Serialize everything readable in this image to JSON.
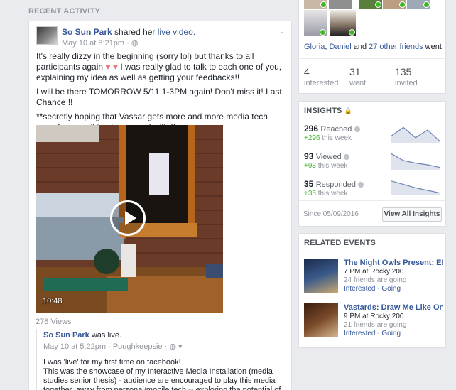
{
  "section_title": "RECENT ACTIVITY",
  "post": {
    "author": "So Sun Park",
    "action_prefix": "shared her",
    "action_link": "live video.",
    "time": "May 10 at 8:21pm ·",
    "menu_glyph": "⌄",
    "paragraphs": [
      "It's really dizzy in the beginning (sorry lol) but thanks to all participants again",
      "I will be there TOMORROW 5/11 1-3PM again! Don't miss it! Last Chance !!",
      "**secretly hoping that Vassar gets more and more media tech resrc for you all to play around with !!"
    ],
    "hearts": "♥ ♥",
    "para1_tail": "I was really glad to talk to each one of you, explaining my idea as well as getting your feedbacks!!",
    "video_duration": "10:48",
    "views": "278 Views",
    "shared": {
      "author": "So Sun Park",
      "action": "was live.",
      "meta": "May 10 at 5:22pm · Poughkeepsie · ",
      "body_lines": [
        "I was 'live' for my first time on facebook!",
        "This was the showcase of my Interactive Media Installation (media studies senior thesis) - audience are encouraged to play this media together, away from personal/mobile tech -- exploring the potential of tech creating live social interaction"
      ]
    }
  },
  "friends": {
    "names_a": "Gloria",
    "names_b": "Daniel",
    "and": "and",
    "others": "27 other friends",
    "went": "went",
    "sep": ", "
  },
  "stats": [
    {
      "num": "4",
      "label": "interested"
    },
    {
      "num": "31",
      "label": "went"
    },
    {
      "num": "135",
      "label": "invited"
    }
  ],
  "insights": {
    "title": "INSIGHTS",
    "lock_icon": "lock-icon",
    "metrics": [
      {
        "value": "296",
        "label": "Reached",
        "delta": "+296",
        "delta_suffix": "this week",
        "trend": [
          0.4,
          0.9,
          0.3,
          0.75,
          0.1
        ]
      },
      {
        "value": "93",
        "label": "Viewed",
        "delta": "+93",
        "delta_suffix": "this week",
        "trend": [
          0.9,
          0.5,
          0.35,
          0.25,
          0.1
        ]
      },
      {
        "value": "35",
        "label": "Responded",
        "delta": "+35",
        "delta_suffix": "this week",
        "trend": [
          0.8,
          0.6,
          0.4,
          0.25,
          0.1
        ]
      }
    ],
    "since": "Since 05/09/2016",
    "button": "View All Insights"
  },
  "related": {
    "title": "RELATED EVENTS",
    "events": [
      {
        "title": "The Night Owls Present: EMO...",
        "when": "7 PM at Rocky 200",
        "sub": "24 friends are going",
        "interested": "Interested",
        "going": "Going"
      },
      {
        "title": "Vastards: Draw Me Like One O...",
        "when": "9 PM at Rocky 200",
        "sub": "21 friends are going",
        "interested": "Interested",
        "going": "Going"
      }
    ],
    "dot": " · "
  },
  "colors": {
    "brand": "#365899",
    "positive": "#42b72a",
    "spark": "#6d84b4"
  }
}
